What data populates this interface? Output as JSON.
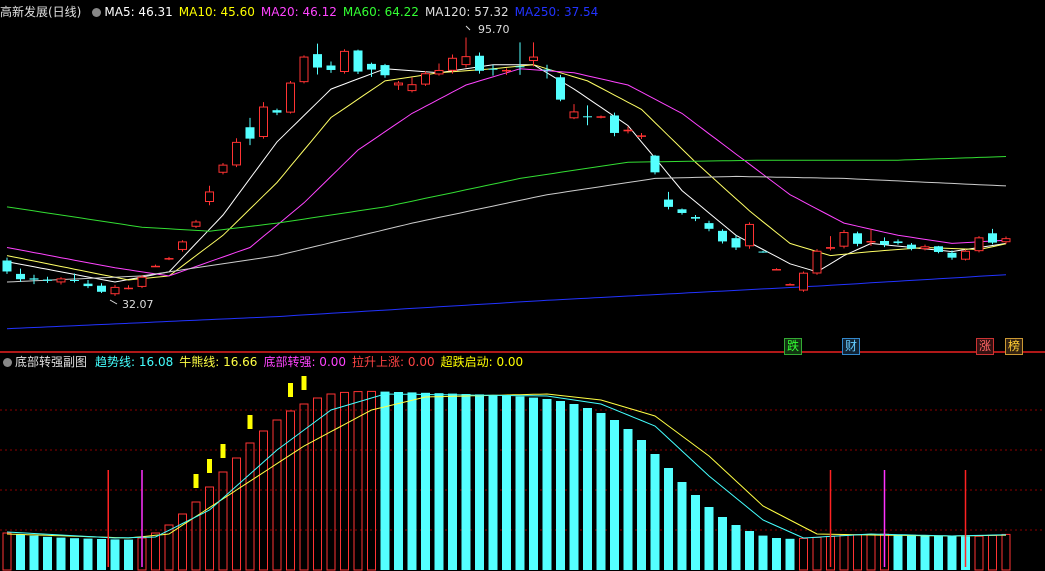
{
  "upper_panel": {
    "title": "高新发展(日线)",
    "indicators": [
      {
        "label": "MA5: 46.31",
        "color": "#ffffff"
      },
      {
        "label": "MA10: 45.60",
        "color": "#ffff00"
      },
      {
        "label": "MA20: 46.12",
        "color": "#ff44ff"
      },
      {
        "label": "MA60: 64.22",
        "color": "#33ff33"
      },
      {
        "label": "MA120: 57.32",
        "color": "#dddddd"
      },
      {
        "label": "MA250: 37.54",
        "color": "#2233ff"
      }
    ],
    "high_label": "95.70",
    "low_label": "32.07",
    "tags": [
      {
        "text": "跌",
        "color": "#33ff33",
        "border": "#33aa33",
        "bg": "#113311"
      },
      {
        "text": "财",
        "color": "#66ccff",
        "border": "#3388cc",
        "bg": "#102233"
      },
      {
        "text": "涨",
        "color": "#ff6666",
        "border": "#cc3333",
        "bg": "#331111"
      },
      {
        "text": "榜",
        "color": "#ffcc33",
        "border": "#cc9933",
        "bg": "#332211"
      }
    ]
  },
  "lower_panel": {
    "title": "底部转强副图",
    "indicators": [
      {
        "label": "趋势线: 16.08",
        "color": "#44ffff"
      },
      {
        "label": "牛熊线: 16.66",
        "color": "#ffff44"
      },
      {
        "label": "底部转强: 0.00",
        "color": "#ff44ff"
      },
      {
        "label": "拉升上涨: 0.00",
        "color": "#ff4444"
      },
      {
        "label": "超跌启动: 0.00",
        "color": "#ffff00"
      }
    ]
  },
  "colors": {
    "up": "#ff3333",
    "down": "#54ffff",
    "grid": "#8b0000",
    "divider": "#b01818"
  },
  "chart_data": [
    {
      "type": "candlestick",
      "title": "高新发展(日线)",
      "y_range": [
        20,
        100
      ],
      "candles": [
        {
          "o": 40.8,
          "h": 41.5,
          "l": 37.5,
          "c": 38.1
        },
        {
          "o": 37.5,
          "h": 38.8,
          "l": 35.5,
          "c": 36.2
        },
        {
          "o": 36.4,
          "h": 37.3,
          "l": 35.0,
          "c": 36.1
        },
        {
          "o": 36.1,
          "h": 36.8,
          "l": 35.3,
          "c": 35.8
        },
        {
          "o": 35.4,
          "h": 36.7,
          "l": 34.9,
          "c": 36.4
        },
        {
          "o": 36.0,
          "h": 37.6,
          "l": 35.4,
          "c": 35.8
        },
        {
          "o": 35.1,
          "h": 36.0,
          "l": 34.0,
          "c": 34.5
        },
        {
          "o": 34.6,
          "h": 35.2,
          "l": 32.8,
          "c": 33.1
        },
        {
          "o": 32.5,
          "h": 34.8,
          "l": 32.1,
          "c": 34.3
        },
        {
          "o": 34.1,
          "h": 34.7,
          "l": 33.7,
          "c": 34.1
        },
        {
          "o": 34.3,
          "h": 37.2,
          "l": 34.0,
          "c": 36.8
        },
        {
          "o": 39.5,
          "h": 39.8,
          "l": 39.2,
          "c": 39.5
        },
        {
          "o": 41.2,
          "h": 41.7,
          "l": 40.9,
          "c": 41.4
        },
        {
          "o": 43.4,
          "h": 45.8,
          "l": 43.0,
          "c": 45.5
        },
        {
          "o": 49.1,
          "h": 50.8,
          "l": 48.8,
          "c": 50.4
        },
        {
          "o": 55.2,
          "h": 59.2,
          "l": 54.4,
          "c": 57.8
        },
        {
          "o": 62.4,
          "h": 64.8,
          "l": 62.0,
          "c": 64.4
        },
        {
          "o": 64.2,
          "h": 70.9,
          "l": 63.8,
          "c": 70.0
        },
        {
          "o": 73.6,
          "h": 75.9,
          "l": 69.2,
          "c": 70.8
        },
        {
          "o": 71.2,
          "h": 79.8,
          "l": 70.8,
          "c": 78.7
        },
        {
          "o": 77.8,
          "h": 78.2,
          "l": 76.6,
          "c": 77.2
        },
        {
          "o": 77.2,
          "h": 85.0,
          "l": 77.0,
          "c": 84.6
        },
        {
          "o": 84.7,
          "h": 91.3,
          "l": 84.4,
          "c": 91.0
        },
        {
          "o": 91.6,
          "h": 94.2,
          "l": 86.6,
          "c": 88.3
        },
        {
          "o": 88.8,
          "h": 89.8,
          "l": 87.0,
          "c": 87.7
        },
        {
          "o": 87.2,
          "h": 92.8,
          "l": 86.8,
          "c": 92.4
        },
        {
          "o": 92.5,
          "h": 92.7,
          "l": 86.7,
          "c": 87.3
        },
        {
          "o": 89.2,
          "h": 89.5,
          "l": 86.0,
          "c": 87.8
        },
        {
          "o": 88.9,
          "h": 89.2,
          "l": 85.8,
          "c": 86.4
        },
        {
          "o": 83.9,
          "h": 85.0,
          "l": 82.8,
          "c": 84.6
        },
        {
          "o": 82.5,
          "h": 85.9,
          "l": 82.2,
          "c": 84.2
        },
        {
          "o": 84.1,
          "h": 87.4,
          "l": 83.8,
          "c": 86.9
        },
        {
          "o": 86.6,
          "h": 89.3,
          "l": 86.3,
          "c": 87.7
        },
        {
          "o": 87.5,
          "h": 91.5,
          "l": 86.8,
          "c": 90.7
        },
        {
          "o": 88.9,
          "h": 95.7,
          "l": 88.3,
          "c": 91.1
        },
        {
          "o": 91.2,
          "h": 92.0,
          "l": 86.8,
          "c": 87.5
        },
        {
          "o": 88.0,
          "h": 89.0,
          "l": 86.3,
          "c": 87.8
        },
        {
          "o": 87.7,
          "h": 88.1,
          "l": 86.5,
          "c": 87.7
        },
        {
          "o": 88.6,
          "h": 94.5,
          "l": 86.5,
          "c": 88.4
        },
        {
          "o": 89.9,
          "h": 94.5,
          "l": 88.6,
          "c": 91.0
        },
        {
          "o": 87.8,
          "h": 89.0,
          "l": 85.6,
          "c": 87.6
        },
        {
          "o": 85.9,
          "h": 86.5,
          "l": 80.0,
          "c": 80.4
        },
        {
          "o": 75.8,
          "h": 79.3,
          "l": 75.6,
          "c": 77.5
        },
        {
          "o": 76.3,
          "h": 79.0,
          "l": 74.1,
          "c": 76.1
        },
        {
          "o": 76.3,
          "h": 76.5,
          "l": 75.8,
          "c": 76.3
        },
        {
          "o": 76.5,
          "h": 77.2,
          "l": 71.4,
          "c": 72.2
        },
        {
          "o": 72.6,
          "h": 73.8,
          "l": 72.1,
          "c": 73.0
        },
        {
          "o": 71.4,
          "h": 72.2,
          "l": 70.7,
          "c": 71.6
        },
        {
          "o": 66.6,
          "h": 66.8,
          "l": 62.0,
          "c": 62.5
        },
        {
          "o": 55.8,
          "h": 57.7,
          "l": 53.4,
          "c": 54.0
        },
        {
          "o": 53.4,
          "h": 53.6,
          "l": 52.1,
          "c": 52.5
        },
        {
          "o": 51.5,
          "h": 52.0,
          "l": 50.5,
          "c": 51.1
        },
        {
          "o": 50.0,
          "h": 50.6,
          "l": 48.0,
          "c": 48.6
        },
        {
          "o": 48.1,
          "h": 48.5,
          "l": 45.0,
          "c": 45.5
        },
        {
          "o": 46.3,
          "h": 47.0,
          "l": 43.4,
          "c": 44.0
        },
        {
          "o": 44.3,
          "h": 50.2,
          "l": 43.7,
          "c": 49.8
        },
        {
          "o": 43.0,
          "h": 43.2,
          "l": 42.7,
          "c": 42.9
        },
        {
          "o": 38.7,
          "h": 38.9,
          "l": 38.5,
          "c": 38.7
        },
        {
          "o": 35.0,
          "h": 35.2,
          "l": 34.8,
          "c": 35.0
        },
        {
          "o": 33.4,
          "h": 38.1,
          "l": 33.1,
          "c": 37.8
        },
        {
          "o": 37.6,
          "h": 43.6,
          "l": 37.3,
          "c": 43.2
        },
        {
          "o": 43.7,
          "h": 46.8,
          "l": 43.3,
          "c": 44.1
        },
        {
          "o": 44.2,
          "h": 48.3,
          "l": 43.8,
          "c": 47.8
        },
        {
          "o": 47.5,
          "h": 47.9,
          "l": 44.3,
          "c": 44.9
        },
        {
          "o": 45.3,
          "h": 48.6,
          "l": 44.4,
          "c": 45.6
        },
        {
          "o": 45.6,
          "h": 46.5,
          "l": 44.1,
          "c": 44.7
        },
        {
          "o": 45.5,
          "h": 46.0,
          "l": 44.7,
          "c": 45.1
        },
        {
          "o": 44.7,
          "h": 45.1,
          "l": 43.3,
          "c": 43.7
        },
        {
          "o": 43.6,
          "h": 44.7,
          "l": 43.3,
          "c": 44.3
        },
        {
          "o": 44.3,
          "h": 44.4,
          "l": 42.6,
          "c": 42.9
        },
        {
          "o": 42.7,
          "h": 43.3,
          "l": 41.0,
          "c": 41.5
        },
        {
          "o": 41.0,
          "h": 43.5,
          "l": 40.8,
          "c": 43.2
        },
        {
          "o": 43.1,
          "h": 46.8,
          "l": 42.8,
          "c": 46.5
        },
        {
          "o": 47.5,
          "h": 48.6,
          "l": 44.8,
          "c": 45.2
        },
        {
          "o": 45.3,
          "h": 46.7,
          "l": 44.9,
          "c": 46.3
        }
      ],
      "moving_averages": [
        {
          "name": "MA5",
          "color": "#ffffff",
          "values": [
            [
              0,
              40.5
            ],
            [
              8,
              35.5
            ],
            [
              12,
              38
            ],
            [
              16,
              52
            ],
            [
              20,
              70
            ],
            [
              24,
              83
            ],
            [
              28,
              88
            ],
            [
              32,
              87
            ],
            [
              36,
              89
            ],
            [
              39,
              89
            ],
            [
              42,
              83
            ],
            [
              46,
              74
            ],
            [
              50,
              58
            ],
            [
              54,
              47
            ],
            [
              58,
              40
            ],
            [
              60,
              38
            ],
            [
              62,
              42
            ],
            [
              64,
              45
            ],
            [
              67,
              44
            ],
            [
              70,
              43
            ],
            [
              75,
              45.5
            ]
          ]
        },
        {
          "name": "MA10",
          "color": "#ffff66",
          "values": [
            [
              0,
              42
            ],
            [
              9,
              36
            ],
            [
              12,
              37
            ],
            [
              16,
              47
            ],
            [
              20,
              60
            ],
            [
              24,
              76
            ],
            [
              28,
              85
            ],
            [
              32,
              87
            ],
            [
              36,
              88
            ],
            [
              39,
              89
            ],
            [
              43,
              85
            ],
            [
              47,
              78
            ],
            [
              51,
              65
            ],
            [
              55,
              53
            ],
            [
              58,
              45
            ],
            [
              61,
              42
            ],
            [
              64,
              43
            ],
            [
              68,
              44
            ],
            [
              72,
              43.5
            ],
            [
              75,
              45.6
            ]
          ]
        },
        {
          "name": "MA20",
          "color": "#ff44ff",
          "values": [
            [
              0,
              44
            ],
            [
              8,
              39
            ],
            [
              12,
              37
            ],
            [
              18,
              44
            ],
            [
              22,
              55
            ],
            [
              26,
              68
            ],
            [
              30,
              77
            ],
            [
              34,
              84
            ],
            [
              38,
              88
            ],
            [
              42,
              87
            ],
            [
              46,
              84
            ],
            [
              50,
              77
            ],
            [
              54,
              67
            ],
            [
              58,
              57
            ],
            [
              62,
              50
            ],
            [
              66,
              47
            ],
            [
              70,
              45
            ],
            [
              75,
              46
            ]
          ]
        },
        {
          "name": "MA60",
          "color": "#33dd33",
          "values": [
            [
              0,
              54
            ],
            [
              10,
              49
            ],
            [
              15,
              48
            ],
            [
              20,
              50
            ],
            [
              28,
              54
            ],
            [
              38,
              61
            ],
            [
              46,
              65
            ],
            [
              56,
              65.5
            ],
            [
              66,
              65.5
            ],
            [
              75,
              66.5
            ]
          ]
        },
        {
          "name": "MA120",
          "color": "#cccccc",
          "values": [
            [
              0,
              35.5
            ],
            [
              10,
              37
            ],
            [
              20,
              42
            ],
            [
              30,
              50
            ],
            [
              40,
              57
            ],
            [
              48,
              61
            ],
            [
              54,
              61.5
            ],
            [
              62,
              61
            ],
            [
              75,
              59
            ]
          ]
        },
        {
          "name": "MA250",
          "color": "#2233ff",
          "values": [
            [
              0,
              24
            ],
            [
              20,
              27
            ],
            [
              40,
              31
            ],
            [
              60,
              34.5
            ],
            [
              75,
              37.5
            ]
          ]
        }
      ]
    },
    {
      "type": "bar",
      "title": "底部转强副图",
      "y_range": [
        0,
        100
      ],
      "bars": [
        18.5,
        17.8,
        17.2,
        16.6,
        16.2,
        15.9,
        15.7,
        15.5,
        15.3,
        15.2,
        16,
        18.5,
        22.5,
        28,
        34,
        41.5,
        49,
        56,
        63.5,
        69.5,
        75,
        79.5,
        83,
        86,
        88,
        88.8,
        89.2,
        89.3,
        89.2,
        89,
        88.8,
        88.6,
        88.4,
        88.2,
        88,
        87.8,
        87.5,
        87.2,
        86.8,
        86.2,
        85.5,
        84.5,
        83,
        81,
        78.5,
        75,
        70.5,
        65,
        58,
        51,
        44,
        37.5,
        31.5,
        26.5,
        22.5,
        19.5,
        17.2,
        16,
        15.6,
        15.8,
        16.3,
        16.8,
        17.3,
        17.6,
        17.8,
        17.9,
        17.8,
        17.6,
        17.4,
        17.2,
        17.0,
        16.8,
        16.9,
        17.3,
        17.8
      ],
      "trend_line": [
        [
          0,
          19
        ],
        [
          8,
          16
        ],
        [
          11,
          16.5
        ],
        [
          15,
          30
        ],
        [
          20,
          60
        ],
        [
          24,
          80
        ],
        [
          28,
          88
        ],
        [
          40,
          87
        ],
        [
          44,
          83
        ],
        [
          48,
          72
        ],
        [
          52,
          47
        ],
        [
          56,
          25
        ],
        [
          59,
          16
        ],
        [
          64,
          18
        ],
        [
          70,
          17
        ],
        [
          75,
          17.8
        ]
      ],
      "bull_bear_line": [
        [
          0,
          18
        ],
        [
          9,
          16
        ],
        [
          12,
          18
        ],
        [
          17,
          40
        ],
        [
          22,
          62
        ],
        [
          27,
          80
        ],
        [
          31,
          86.5
        ],
        [
          40,
          88
        ],
        [
          44,
          85
        ],
        [
          48,
          77
        ],
        [
          52,
          57
        ],
        [
          56,
          32
        ],
        [
          60,
          18
        ],
        [
          64,
          17.5
        ],
        [
          70,
          17
        ],
        [
          75,
          17.5
        ]
      ],
      "signals": [
        {
          "x": 7.5,
          "type": "拉升上涨",
          "color": "#ff2222"
        },
        {
          "x": 10.0,
          "type": "底部转强",
          "color": "#ff33ff"
        },
        {
          "x": 61.0,
          "type": "拉升上涨",
          "color": "#ff2222"
        },
        {
          "x": 65.0,
          "type": "底部转强",
          "color": "#ff33ff"
        },
        {
          "x": 71.0,
          "type": "拉升上涨",
          "color": "#ff2222"
        }
      ],
      "markers": [
        14,
        15,
        16,
        18,
        21,
        22
      ]
    }
  ]
}
